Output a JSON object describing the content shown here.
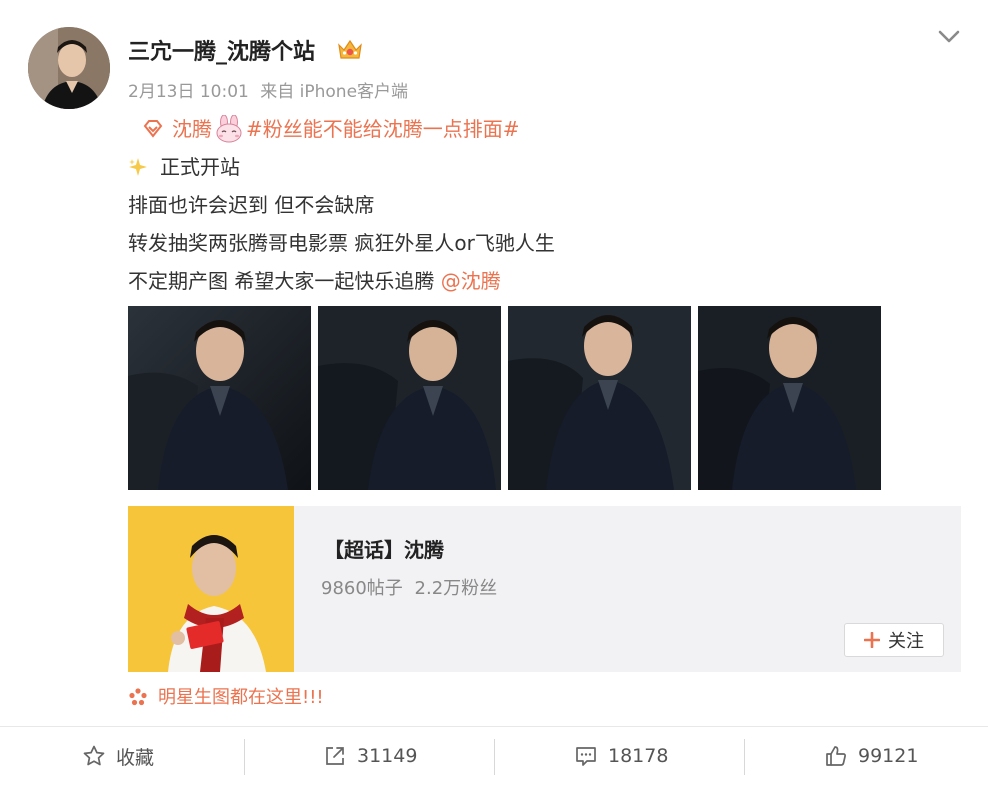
{
  "post": {
    "username": "三宂一腾_沈腾个站",
    "date": "2月13日 10:01",
    "source": "来自 iPhone客户端",
    "icons": {
      "crown": "vip-crown-icon",
      "more": "chevron-down-icon",
      "sparkle": "sparkle-icon",
      "diamond": "super-topic-diamond-icon",
      "bunny": "bunny-emoji-icon"
    },
    "topic_link": "沈腾",
    "topic_hashtag": "#粉丝能不能给沈腾一点排面#",
    "lines": {
      "line1": "正式开站",
      "line2": "排面也许会迟到 但不会缺席",
      "line3": "转发抽奖两张腾哥电影票 疯狂外星人or飞驰人生",
      "line4_text": "不定期产图 希望大家一起快乐追腾 ",
      "line4_mention": "@沈腾"
    },
    "photo_count": 4
  },
  "card": {
    "title": "【超话】沈腾",
    "posts": "9860帖子",
    "fans": "2.2万粉丝",
    "follow_label": "关注"
  },
  "star_link": "明星生图都在这里!!!",
  "actions": {
    "favorite": "收藏",
    "repost": "31149",
    "comment": "18178",
    "like": "99121"
  },
  "colors": {
    "accent_orange": "#eb7350",
    "meta_gray": "#999999",
    "card_bg": "#f2f2f5",
    "card_thumb_bg": "#f6c53a"
  }
}
